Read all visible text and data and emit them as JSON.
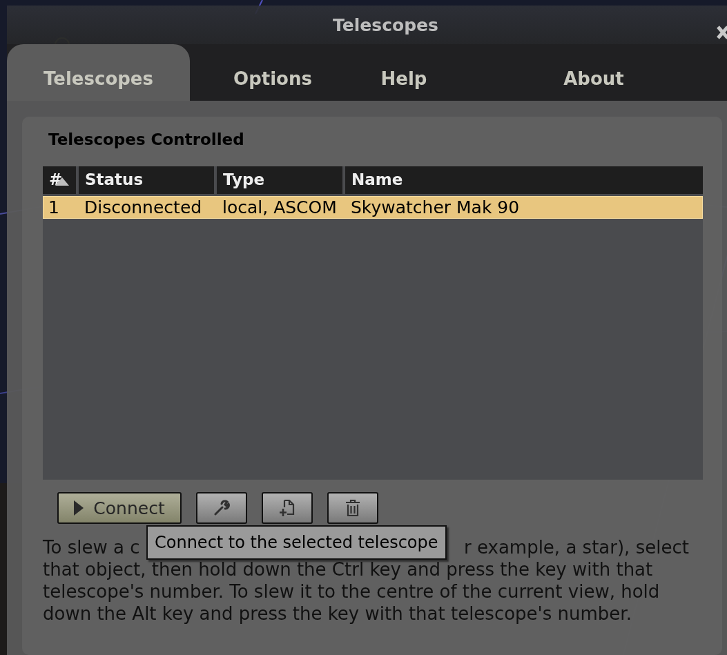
{
  "window": {
    "title": "Telescopes"
  },
  "tabs": [
    {
      "label": "Telescopes",
      "selected": true
    },
    {
      "label": "Options",
      "selected": false
    },
    {
      "label": "Help",
      "selected": false
    },
    {
      "label": "About",
      "selected": false
    }
  ],
  "group": {
    "title": "Telescopes Controlled"
  },
  "table": {
    "columns": [
      "#",
      "Status",
      "Type",
      "Name"
    ],
    "rows": [
      {
        "cells": [
          "1",
          "Disconnected",
          "local, ASCOM",
          "Skywatcher Mak 90"
        ],
        "selected": true
      }
    ]
  },
  "toolbar": {
    "connect_label": "Connect",
    "tooltip": "Connect to the selected telescope"
  },
  "help": {
    "first_line_start": "To slew a c",
    "first_line_end": "r example, a star), select",
    "lines": [
      "that object, then hold down the Ctrl key and press the key with that",
      "telescope's number. To slew it to the centre of the current view, hold",
      "down the Alt key and press the key with that telescope's number."
    ]
  }
}
